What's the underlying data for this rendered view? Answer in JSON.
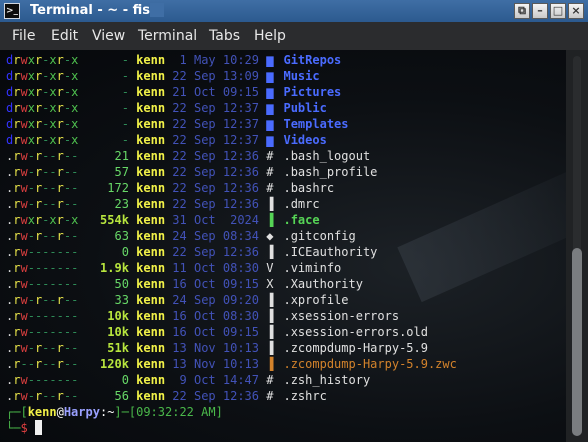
{
  "window": {
    "title": "Terminal - ~ - fish",
    "buttons": [
      "⧉",
      "–",
      "□",
      "×"
    ]
  },
  "menu": [
    "File",
    "Edit",
    "View",
    "Terminal",
    "Tabs",
    "Help"
  ],
  "icons": {
    "folder": "folder-icon",
    "file": "file-icon",
    "hash": "hash-icon",
    "git": "git-icon",
    "vim": "vim-icon",
    "x": "x-icon"
  },
  "listing": [
    {
      "perm": "drwxr-xr-x",
      "size": "-",
      "user": "kenn",
      "date": "1 May 10:29",
      "icon": "folder",
      "name": "GitRepos",
      "kind": "dir"
    },
    {
      "perm": "drwxr-xr-x",
      "size": "-",
      "user": "kenn",
      "date": "22 Sep 13:09",
      "icon": "folder",
      "name": "Music",
      "kind": "dir"
    },
    {
      "perm": "drwxr-xr-x",
      "size": "-",
      "user": "kenn",
      "date": "21 Oct 09:15",
      "icon": "folder",
      "name": "Pictures",
      "kind": "dir"
    },
    {
      "perm": "drwxr-xr-x",
      "size": "-",
      "user": "kenn",
      "date": "22 Sep 12:37",
      "icon": "folder",
      "name": "Public",
      "kind": "dir"
    },
    {
      "perm": "drwxr-xr-x",
      "size": "-",
      "user": "kenn",
      "date": "22 Sep 12:37",
      "icon": "folder",
      "name": "Templates",
      "kind": "dir"
    },
    {
      "perm": "drwxr-xr-x",
      "size": "-",
      "user": "kenn",
      "date": "22 Sep 12:37",
      "icon": "folder",
      "name": "Videos",
      "kind": "dir"
    },
    {
      "perm": ".rw-r--r--",
      "size": "21",
      "user": "kenn",
      "date": "22 Sep 12:36",
      "icon": "hash",
      "name": ".bash_logout",
      "kind": "file"
    },
    {
      "perm": ".rw-r--r--",
      "size": "57",
      "user": "kenn",
      "date": "22 Sep 12:36",
      "icon": "hash",
      "name": ".bash_profile",
      "kind": "file"
    },
    {
      "perm": ".rw-r--r--",
      "size": "172",
      "user": "kenn",
      "date": "22 Sep 12:36",
      "icon": "hash",
      "name": ".bashrc",
      "kind": "file"
    },
    {
      "perm": ".rw-r--r--",
      "size": "23",
      "user": "kenn",
      "date": "22 Sep 12:36",
      "icon": "file",
      "name": ".dmrc",
      "kind": "file"
    },
    {
      "perm": ".rwxr-xr-x",
      "size": "554k",
      "user": "kenn",
      "date": "31 Oct  2024",
      "icon": "file",
      "name": ".face",
      "kind": "exec"
    },
    {
      "perm": ".rw-r--r--",
      "size": "63",
      "user": "kenn",
      "date": "24 Sep 08:34",
      "icon": "git",
      "name": ".gitconfig",
      "kind": "file"
    },
    {
      "perm": ".rw-------",
      "size": "0",
      "user": "kenn",
      "date": "22 Sep 12:36",
      "icon": "file",
      "name": ".ICEauthority",
      "kind": "file"
    },
    {
      "perm": ".rw-------",
      "size": "1.9k",
      "user": "kenn",
      "date": "11 Oct 08:30",
      "icon": "vim",
      "name": ".viminfo",
      "kind": "file"
    },
    {
      "perm": ".rw-------",
      "size": "50",
      "user": "kenn",
      "date": "16 Oct 09:15",
      "icon": "x",
      "name": ".Xauthority",
      "kind": "file"
    },
    {
      "perm": ".rw-r--r--",
      "size": "33",
      "user": "kenn",
      "date": "24 Sep 09:20",
      "icon": "file",
      "name": ".xprofile",
      "kind": "file"
    },
    {
      "perm": ".rw-------",
      "size": "10k",
      "user": "kenn",
      "date": "16 Oct 08:30",
      "icon": "file",
      "name": ".xsession-errors",
      "kind": "file"
    },
    {
      "perm": ".rw-------",
      "size": "10k",
      "user": "kenn",
      "date": "16 Oct 09:15",
      "icon": "file",
      "name": ".xsession-errors.old",
      "kind": "file"
    },
    {
      "perm": ".rw-r--r--",
      "size": "51k",
      "user": "kenn",
      "date": "13 Nov 10:13",
      "icon": "file",
      "name": ".zcompdump-Harpy-5.9",
      "kind": "file"
    },
    {
      "perm": ".r--r--r--",
      "size": "120k",
      "user": "kenn",
      "date": "13 Nov 10:13",
      "icon": "file",
      "name": ".zcompdump-Harpy-5.9.zwc",
      "kind": "orange"
    },
    {
      "perm": ".rw-------",
      "size": "0",
      "user": "kenn",
      "date": "9 Oct 14:47",
      "icon": "hash",
      "name": ".zsh_history",
      "kind": "file"
    },
    {
      "perm": ".rw-r--r--",
      "size": "56",
      "user": "kenn",
      "date": "22 Sep 12:36",
      "icon": "hash",
      "name": ".zshrc",
      "kind": "file"
    }
  ],
  "prompt": {
    "user": "kenn",
    "at": "@",
    "host": "Harpy",
    "cwd": "~",
    "time": "09:32:22 AM",
    "symbol": "$"
  }
}
